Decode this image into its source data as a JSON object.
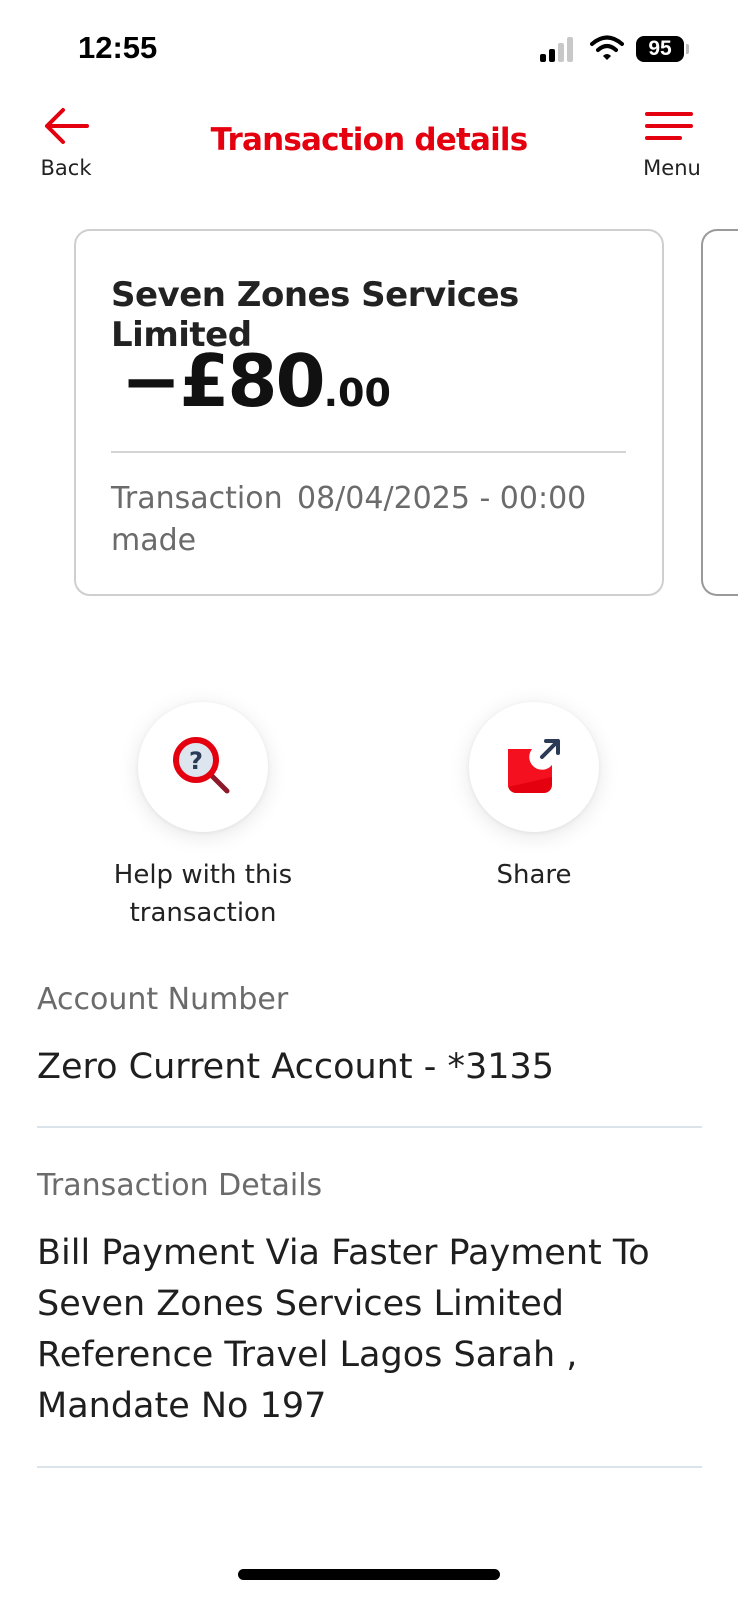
{
  "status_bar": {
    "time": "12:55",
    "battery": "95"
  },
  "header": {
    "back_label": "Back",
    "title": "Transaction details",
    "menu_label": "Menu",
    "accent_color": "#e4000f"
  },
  "card": {
    "merchant": "Seven Zones Services Limited",
    "amount_main": "−£80",
    "amount_pence": ".00",
    "made_label": "Transaction made",
    "made_label_line1": "Transaction",
    "made_label_line2": "made",
    "made_value": "08/04/2025 - 00:00"
  },
  "actions": {
    "help_label": "Help with this transaction",
    "help_icon": "magnifier-question-icon",
    "share_label": "Share",
    "share_icon": "share-out-icon"
  },
  "details": {
    "account_number_label": "Account Number",
    "account_number_value": "Zero Current Account - *3135",
    "transaction_details_label": "Transaction Details",
    "transaction_details_value": "Bill Payment Via Faster Payment To Seven Zones Services Limited Reference Travel Lagos Sarah , Mandate No 197"
  }
}
